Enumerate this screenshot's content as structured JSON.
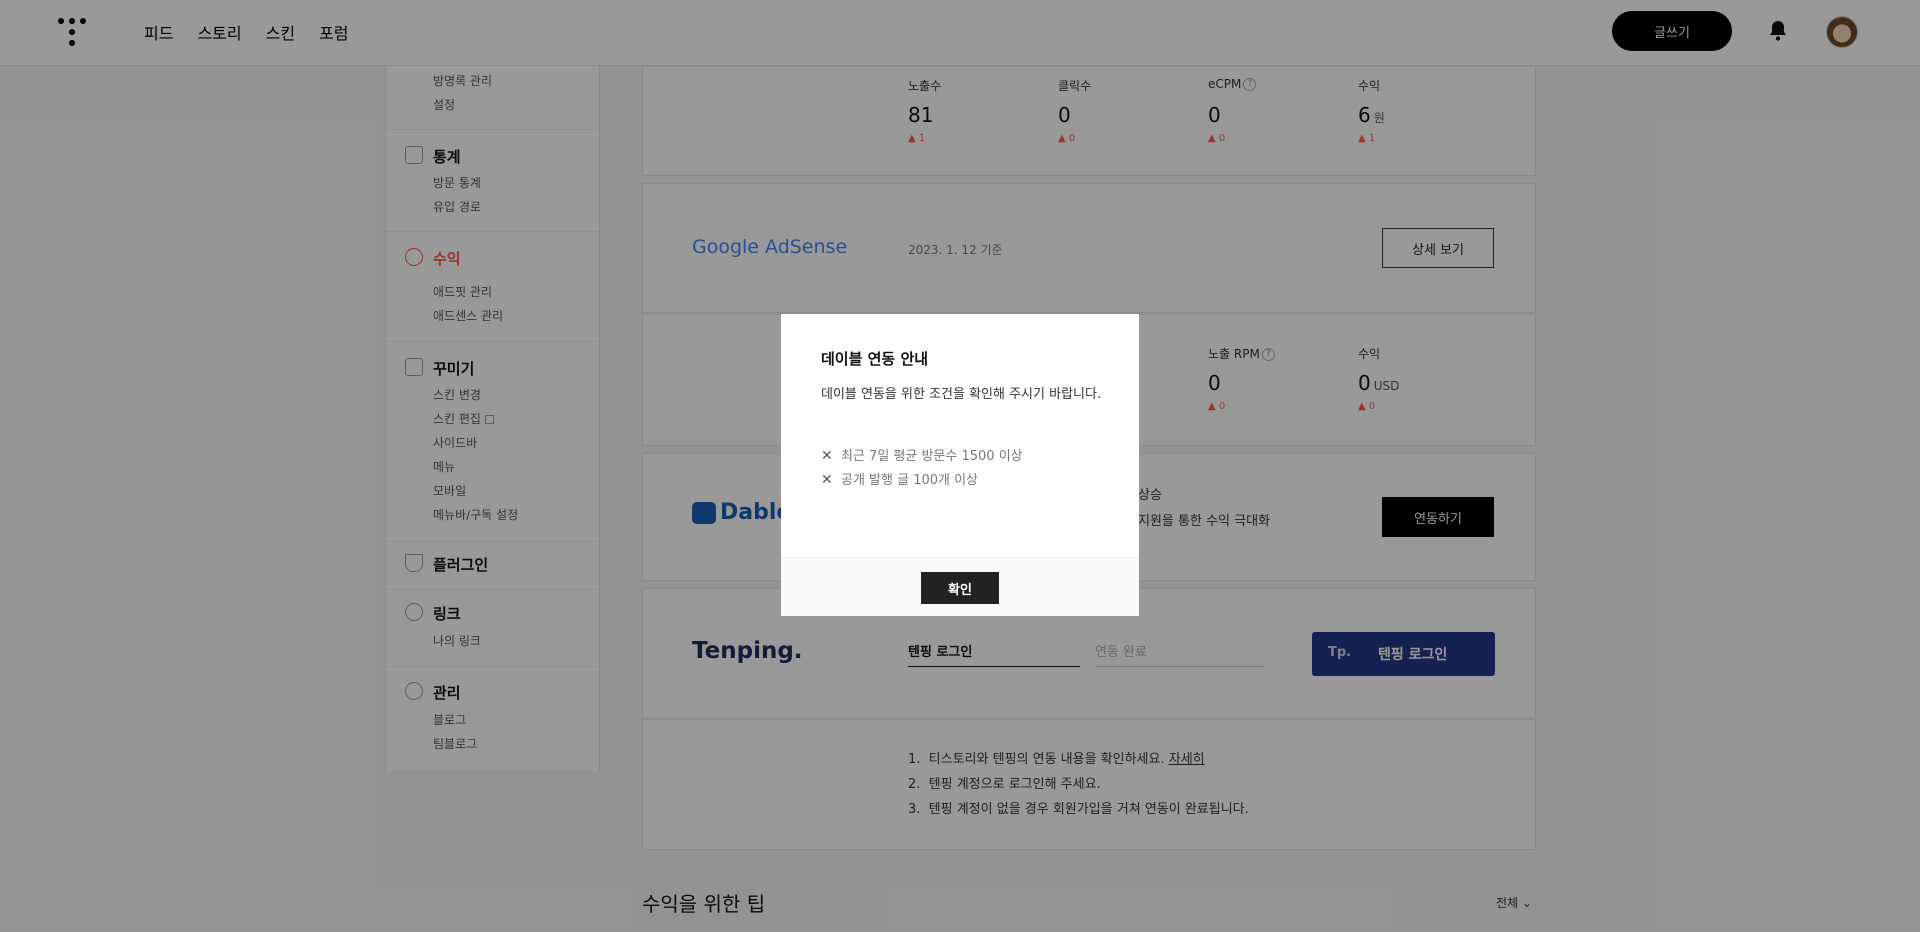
{
  "header": {
    "nav": [
      "피드",
      "스토리",
      "스킨",
      "포럼"
    ],
    "write_label": "글쓰기"
  },
  "sidebar": {
    "top_items": [
      "방명록 관리",
      "설정"
    ],
    "stats": {
      "title": "통계",
      "items": [
        "방문 통계",
        "유입 경로"
      ]
    },
    "revenue": {
      "title": "수익",
      "items": [
        "애드핏 관리",
        "애드센스 관리"
      ]
    },
    "decorate": {
      "title": "꾸미기",
      "items": [
        "스킨 변경",
        "스킨 편집",
        "사이드바",
        "메뉴",
        "모바일",
        "메뉴바/구독 설정"
      ]
    },
    "plugin": {
      "title": "플러그인"
    },
    "link": {
      "title": "링크",
      "items": [
        "나의 링크"
      ]
    },
    "manage": {
      "title": "관리",
      "items": [
        "블로그",
        "팀블로그"
      ]
    }
  },
  "adfit": {
    "metrics": [
      {
        "label": "노출수",
        "value": "81",
        "unit": "",
        "delta": "1"
      },
      {
        "label": "클릭수",
        "value": "0",
        "unit": "",
        "delta": "0"
      },
      {
        "label": "eCPM",
        "value": "0",
        "unit": "",
        "delta": "0"
      },
      {
        "label": "수익",
        "value": "6",
        "unit": "원",
        "delta": "1"
      }
    ]
  },
  "adsense": {
    "brand": "Google AdSense",
    "date": "2023. 1. 12 기준",
    "detail_label": "상세 보기",
    "metrics": [
      {
        "label": "노출 RPM",
        "value": "0",
        "unit": "",
        "delta": "0"
      },
      {
        "label": "수익",
        "value": "0",
        "unit": "USD",
        "delta": "0"
      }
    ]
  },
  "dable": {
    "brand": "Dable",
    "line1": "상승",
    "line2": "지원을 통한 수익 극대화",
    "connect_label": "연동하기"
  },
  "tenping": {
    "brand": "Tenping.",
    "step1": "텐핑 로그인",
    "step2": "연동 완료",
    "login_prefix": "Tp.",
    "login_label": "텐핑 로그인",
    "notes": [
      {
        "num": "1.",
        "text": "티스토리와 텐핑의 연동 내용을 확인하세요.",
        "link": "자세히"
      },
      {
        "num": "2.",
        "text": "텐핑 계정으로 로그인해 주세요."
      },
      {
        "num": "3.",
        "text": "텐핑 계정이 없을 경우 회원가입을 거쳐 연동이 완료됩니다."
      }
    ]
  },
  "tips": {
    "title": "수익을 위한 팁",
    "filter": "전체"
  },
  "modal": {
    "title": "데이블 연동 안내",
    "desc": "데이블 연동을 위한 조건을 확인해 주시기 바랍니다.",
    "conditions": [
      "최근 7일 평균 방문수 1500 이상",
      "공개 발행 글 100개 이상"
    ],
    "confirm_label": "확인"
  },
  "colors": {
    "accent": "#ff5544",
    "tenping": "#243a87",
    "google_blue": "#4285f4",
    "dable_blue": "#1a5fb4"
  }
}
